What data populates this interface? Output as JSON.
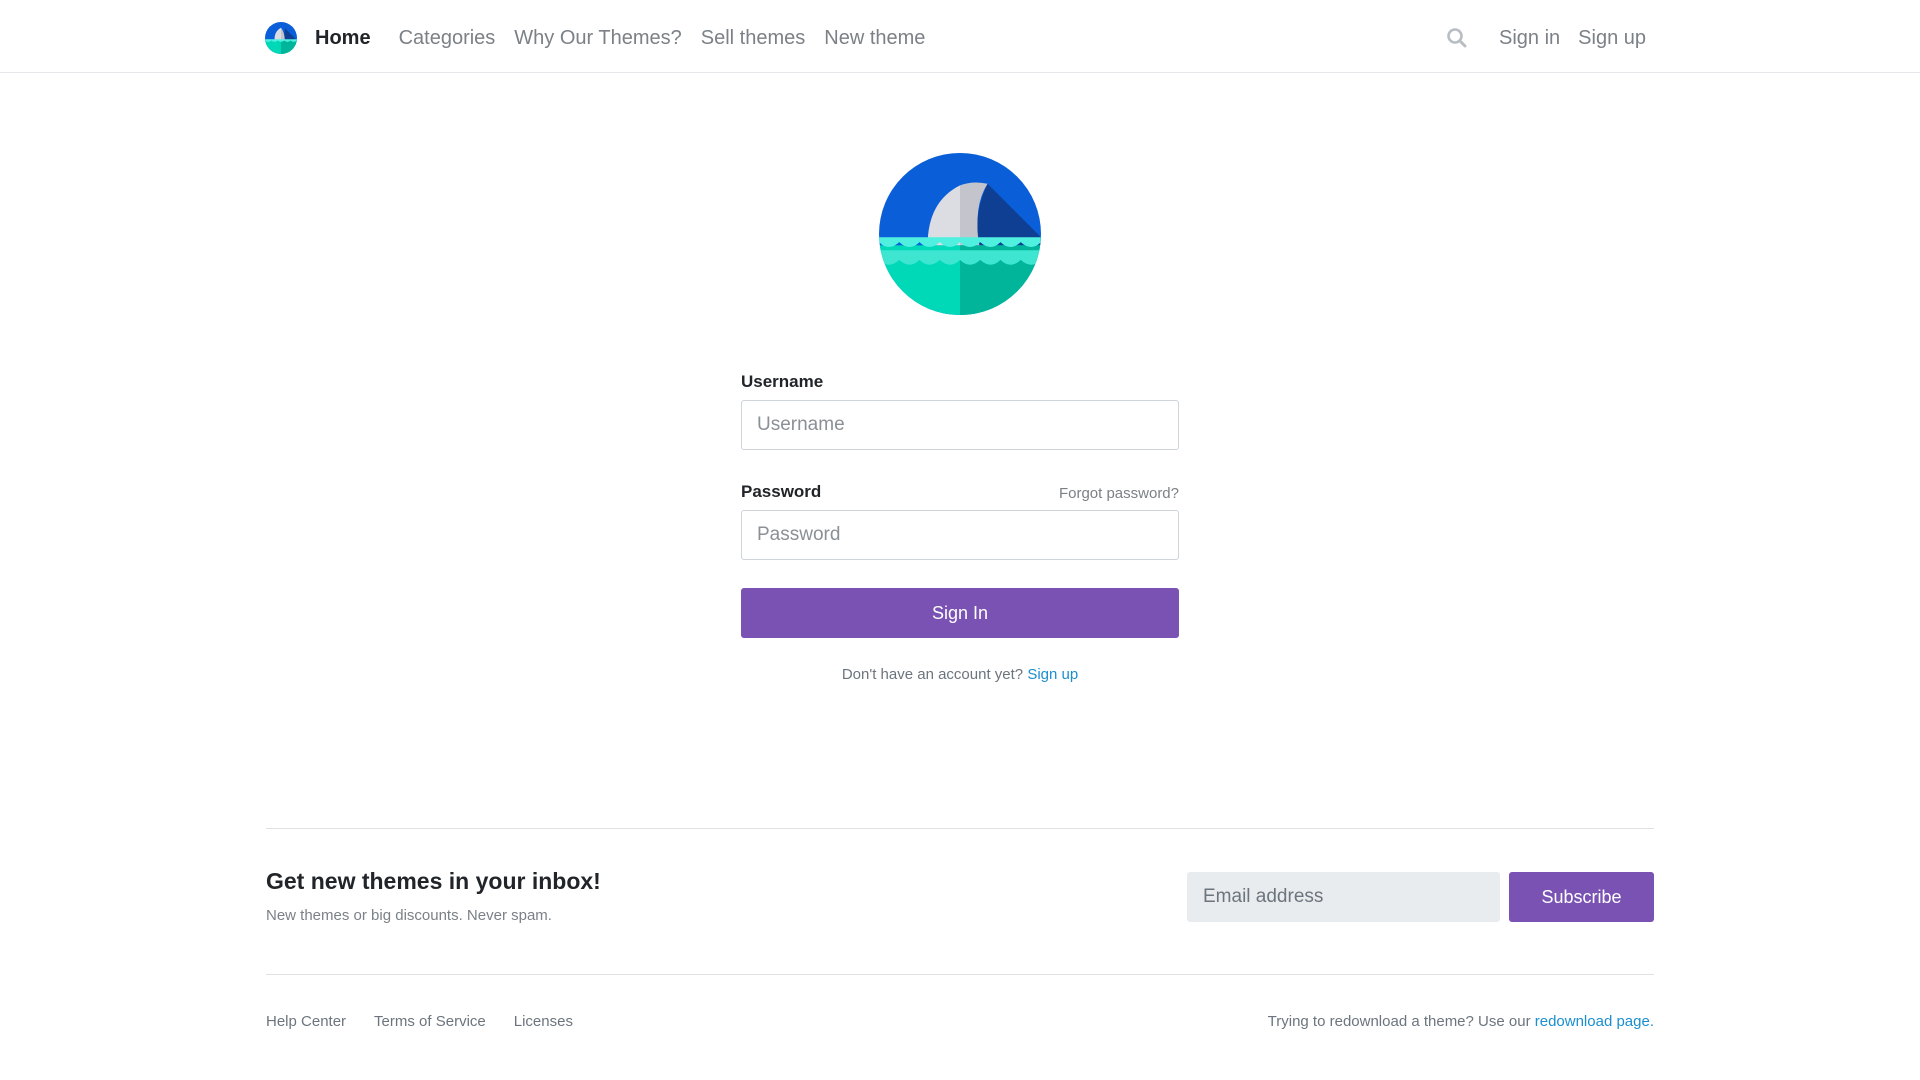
{
  "header": {
    "nav": [
      {
        "label": "Home",
        "active": true
      },
      {
        "label": "Categories"
      },
      {
        "label": "Why Our Themes?"
      },
      {
        "label": "Sell themes"
      },
      {
        "label": "New theme"
      }
    ],
    "search_icon": "search-icon",
    "sign_in": "Sign in",
    "sign_up": "Sign up"
  },
  "form": {
    "username_label": "Username",
    "username_placeholder": "Username",
    "password_label": "Password",
    "password_placeholder": "Password",
    "forgot_password": "Forgot password?",
    "submit_label": "Sign In",
    "no_account_text": "Don't have an account yet?",
    "signup_link": "Sign up"
  },
  "newsletter": {
    "title": "Get new themes in your inbox!",
    "subtitle": "New themes or big discounts. Never spam.",
    "email_placeholder": "Email address",
    "subscribe_label": "Subscribe"
  },
  "footer": {
    "links": [
      "Help Center",
      "Terms of Service",
      "Licenses"
    ],
    "redownload_text": "Trying to redownload a theme? Use our",
    "redownload_link": "redownload page."
  },
  "colors": {
    "accent": "#7952b3",
    "link": "#1b8ecf",
    "logo_blue": "#0a5fd9",
    "logo_teal": "#00d9b8"
  }
}
